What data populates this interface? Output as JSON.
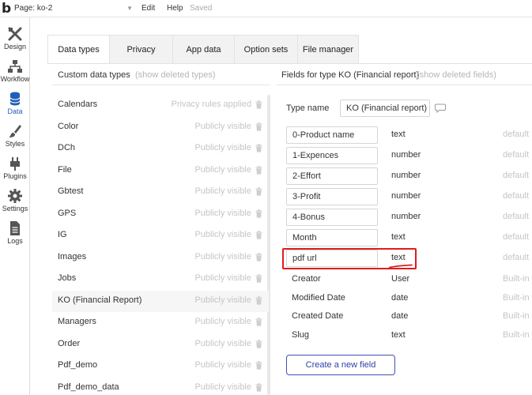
{
  "topbar": {
    "logo": "b",
    "page_select": "Page: ko-2",
    "edit": "Edit",
    "help": "Help",
    "saved": "Saved"
  },
  "sidebar": {
    "items": [
      {
        "label": "Design",
        "icon": "design-icon"
      },
      {
        "label": "Workflow",
        "icon": "workflow-icon"
      },
      {
        "label": "Data",
        "icon": "data-icon",
        "active": true
      },
      {
        "label": "Styles",
        "icon": "styles-icon"
      },
      {
        "label": "Plugins",
        "icon": "plugins-icon"
      },
      {
        "label": "Settings",
        "icon": "settings-icon"
      },
      {
        "label": "Logs",
        "icon": "logs-icon"
      }
    ]
  },
  "tabs": [
    {
      "label": "Data types",
      "active": true
    },
    {
      "label": "Privacy"
    },
    {
      "label": "App data"
    },
    {
      "label": "Option sets"
    },
    {
      "label": "File manager"
    }
  ],
  "types_panel": {
    "title": "Custom data types",
    "show_deleted": "(show deleted types)",
    "types": [
      {
        "name": "Calendars",
        "status": "Privacy rules applied"
      },
      {
        "name": "Color",
        "status": "Publicly visible"
      },
      {
        "name": "DCh",
        "status": "Publicly visible"
      },
      {
        "name": "File",
        "status": "Publicly visible"
      },
      {
        "name": "Gbtest",
        "status": "Publicly visible"
      },
      {
        "name": "GPS",
        "status": "Publicly visible"
      },
      {
        "name": "IG",
        "status": "Publicly visible"
      },
      {
        "name": "Images",
        "status": "Publicly visible"
      },
      {
        "name": "Jobs",
        "status": "Publicly visible"
      },
      {
        "name": "KO (Financial Report)",
        "status": "Publicly visible",
        "selected": true
      },
      {
        "name": "Managers",
        "status": "Publicly visible"
      },
      {
        "name": "Order",
        "status": "Publicly visible"
      },
      {
        "name": "Pdf_demo",
        "status": "Publicly visible"
      },
      {
        "name": "Pdf_demo_data",
        "status": "Publicly visible"
      }
    ]
  },
  "fields_panel": {
    "title": "Fields for type KO (Financial report)",
    "show_deleted": "(show deleted fields)",
    "type_name_label": "Type name",
    "type_name_value": "KO (Financial report)",
    "fields": [
      {
        "name": "0-Product name",
        "type": "text",
        "default": "default"
      },
      {
        "name": "1-Expences",
        "type": "number",
        "default": "default"
      },
      {
        "name": "2-Effort",
        "type": "number",
        "default": "default"
      },
      {
        "name": "3-Profit",
        "type": "number",
        "default": "default"
      },
      {
        "name": "4-Bonus",
        "type": "number",
        "default": "default"
      },
      {
        "name": "Month",
        "type": "text",
        "default": "default"
      },
      {
        "name": "pdf url",
        "type": "text",
        "default": "default",
        "highlighted": true
      }
    ],
    "builtin_fields": [
      {
        "name": "Creator",
        "type": "User",
        "note": "Built-in f"
      },
      {
        "name": "Modified Date",
        "type": "date",
        "note": "Built-in f"
      },
      {
        "name": "Created Date",
        "type": "date",
        "note": "Built-in f"
      },
      {
        "name": "Slug",
        "type": "text",
        "note": "Built-in f"
      }
    ],
    "create_button": "Create a new field"
  },
  "colors": {
    "accent": "#3f51b5",
    "highlight": "#e01b1b",
    "muted": "#c5c5c5"
  }
}
